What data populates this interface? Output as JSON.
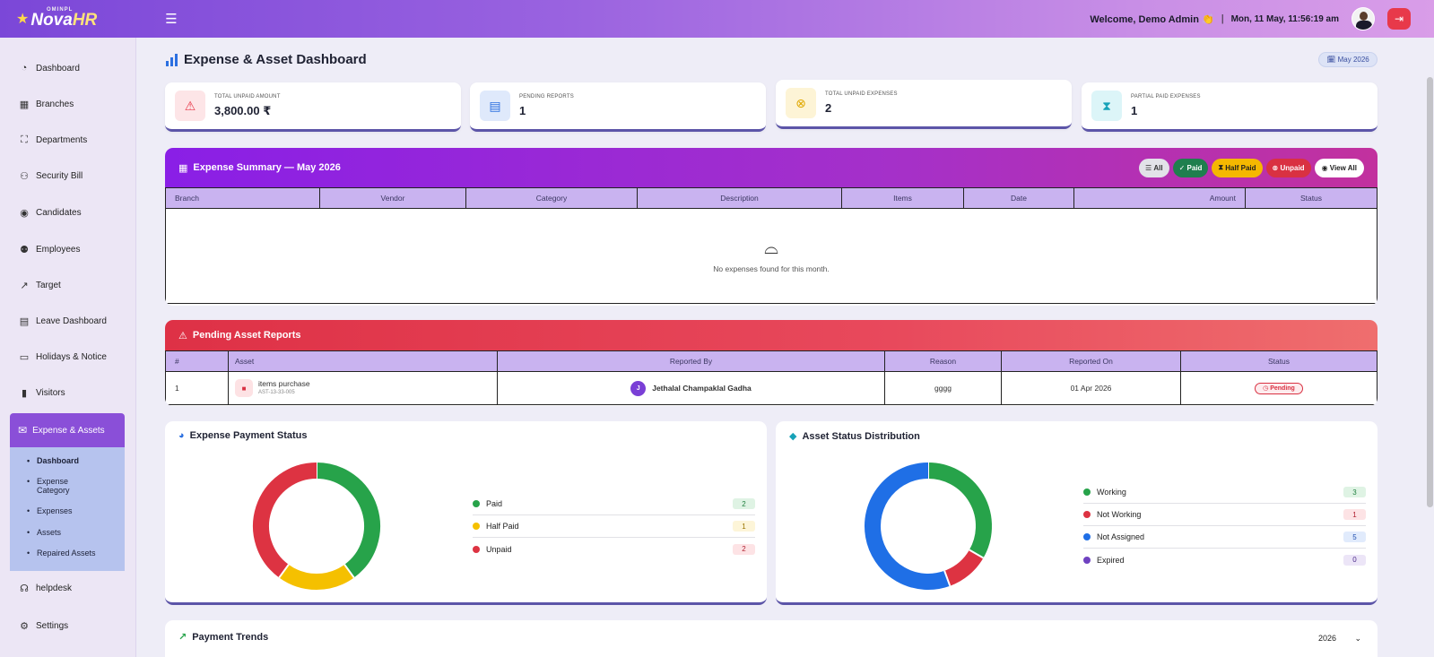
{
  "brand": {
    "super": "OMINPL",
    "name_a": "Nova",
    "name_b": "HR"
  },
  "topbar": {
    "welcome": "Welcome, Demo Admin 👏",
    "separator": "|",
    "datetime": "Mon, 11 May, 11:56:19 am"
  },
  "sidebar": {
    "items": [
      {
        "label": "Dashboard",
        "icon": "speedometer-icon"
      },
      {
        "label": "Branches",
        "icon": "building-icon"
      },
      {
        "label": "Departments",
        "icon": "diagram-icon"
      },
      {
        "label": "Security Bill",
        "icon": "people-icon"
      },
      {
        "label": "Candidates",
        "icon": "person-circle-icon"
      },
      {
        "label": "Employees",
        "icon": "people-fill-icon"
      },
      {
        "label": "Target",
        "icon": "graph-up-icon"
      },
      {
        "label": "Leave Dashboard",
        "icon": "calendar-icon"
      },
      {
        "label": "Holidays & Notice",
        "icon": "calendar-event-icon"
      },
      {
        "label": "Visitors",
        "icon": "door-icon"
      }
    ],
    "active": {
      "label": "Expense & Assets",
      "icon": "envelope-icon"
    },
    "submenu": [
      "Dashboard",
      "Expense Category",
      "Expenses",
      "Assets",
      "Repaired Assets"
    ],
    "bottom": [
      {
        "label": "helpdesk",
        "icon": "headset-icon"
      },
      {
        "label": "Settings",
        "icon": "gear-icon"
      }
    ]
  },
  "page": {
    "title": "Expense & Asset Dashboard",
    "month_badge": "🗓 May 2026"
  },
  "stats": [
    {
      "label": "Total Unpaid Amount",
      "value": "3,800.00 ₹",
      "icon": "warning-icon",
      "color": "#e8394a"
    },
    {
      "label": "Pending Reports",
      "value": "1",
      "icon": "report-icon",
      "color": "#2b6fe0"
    },
    {
      "label": "Total Unpaid Expenses",
      "value": "2",
      "icon": "x-circle-icon",
      "color": "#f5b800"
    },
    {
      "label": "Partial Paid Expenses",
      "value": "1",
      "icon": "hourglass-icon",
      "color": "#17a2b8"
    }
  ],
  "expense_summary": {
    "title": "Expense Summary — May 2026",
    "filters": {
      "all": "All",
      "paid": "Paid",
      "half_paid": "Half Paid",
      "unpaid": "Unpaid",
      "view_all": "View All"
    },
    "columns": [
      "Branch",
      "Vendor",
      "Category",
      "Description",
      "Items",
      "Date",
      "Amount",
      "Status"
    ],
    "empty_text": "No expenses found for this month."
  },
  "asset_reports": {
    "title": "Pending Asset Reports",
    "columns": [
      "#",
      "Asset",
      "Reported By",
      "Reason",
      "Reported On",
      "Status"
    ],
    "rows": [
      {
        "num": "1",
        "asset_name": "items purchase",
        "asset_code": "AST-13-33-005",
        "reporter_initial": "J",
        "reporter": "Jethalal Champaklal Gadha",
        "reason": "gggg",
        "date": "01 Apr 2026",
        "status": "Pending"
      }
    ]
  },
  "payment_status": {
    "title": "Expense Payment Status",
    "legend": [
      {
        "label": "Paid",
        "count": "2",
        "color": "#27a34a"
      },
      {
        "label": "Half Paid",
        "count": "1",
        "color": "#f5c000"
      },
      {
        "label": "Unpaid",
        "count": "2",
        "color": "#dd3342"
      }
    ]
  },
  "asset_status": {
    "title": "Asset Status Distribution",
    "legend": [
      {
        "label": "Working",
        "count": "3",
        "color": "#27a34a"
      },
      {
        "label": "Not Working",
        "count": "1",
        "color": "#dd3342"
      },
      {
        "label": "Not Assigned",
        "count": "5",
        "color": "#1f6fe6"
      },
      {
        "label": "Expired",
        "count": "0",
        "color": "#6f42c1"
      }
    ]
  },
  "chart_data": [
    {
      "type": "pie",
      "title": "Expense Payment Status",
      "categories": [
        "Paid",
        "Half Paid",
        "Unpaid"
      ],
      "values": [
        2,
        1,
        2
      ]
    },
    {
      "type": "pie",
      "title": "Asset Status Distribution",
      "categories": [
        "Working",
        "Not Working",
        "Not Assigned",
        "Expired"
      ],
      "values": [
        3,
        1,
        5,
        0
      ]
    }
  ],
  "trends": {
    "title": "Payment Trends",
    "year": "2026"
  }
}
